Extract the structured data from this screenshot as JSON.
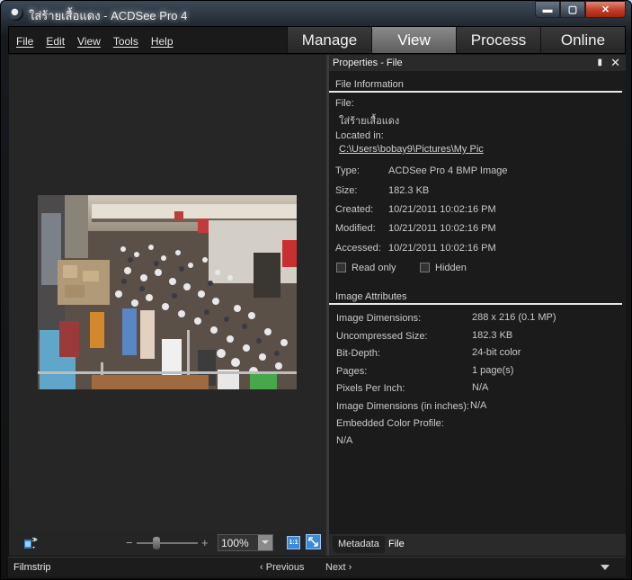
{
  "window": {
    "title": "ใส่ร้ายเสื้อแดง - ACDSee Pro 4",
    "minimize": "▬",
    "maximize": "▢",
    "close": "✕"
  },
  "menu": [
    "File",
    "Edit",
    "View",
    "Tools",
    "Help"
  ],
  "modes": {
    "manage": "Manage",
    "view": "View",
    "process": "Process",
    "online": "Online",
    "active": "View"
  },
  "viewer": {
    "zoom": "100%",
    "zoom_minus": "−",
    "zoom_plus": "+",
    "actual_size_label": "1:1"
  },
  "properties": {
    "title": "Properties - File",
    "pin_icon": "pin-icon",
    "close_icon": "close-icon",
    "file_info_section": "File Information",
    "file_label": "File:",
    "file_name": "ใส่ร้ายเสื้อแดง",
    "located_label": "Located in:",
    "located_value": "C:\\Users\\bobay9\\Pictures\\My Pic",
    "type_label": "Type:",
    "type_value": "ACDSee Pro 4 BMP Image",
    "size_label": "Size:",
    "size_value": "182.3 KB",
    "created_label": "Created:",
    "created_value": "10/21/2011 10:02:16 PM",
    "modified_label": "Modified:",
    "modified_value": "10/21/2011 10:02:16 PM",
    "accessed_label": "Accessed:",
    "accessed_value": "10/21/2011 10:02:16 PM",
    "readonly_label": "Read only",
    "hidden_label": "Hidden",
    "image_attr_section": "Image Attributes",
    "attributes": [
      {
        "label": "Image Dimensions:",
        "value": "288 x 216 (0.1 MP)"
      },
      {
        "label": "Uncompressed Size:",
        "value": "182.3 KB"
      },
      {
        "label": "Bit-Depth:",
        "value": "24-bit color"
      },
      {
        "label": "Pages:",
        "value": "1 page(s)"
      },
      {
        "label": "Pixels Per Inch:",
        "value": "N/A"
      },
      {
        "label": "Image Dimensions (in inches):",
        "value": "N/A"
      }
    ],
    "color_profile_label": "Embedded Color Profile:",
    "color_profile_value": "N/A",
    "tabs": {
      "metadata": "Metadata",
      "file": "File"
    }
  },
  "status": {
    "filmstrip": "Filmstrip",
    "previous": "Previous",
    "next": "Next"
  },
  "colors": {
    "accent_blue": "#3b8ad8",
    "close_red": "#c4412b",
    "panel_bg": "#1b1b1b"
  }
}
